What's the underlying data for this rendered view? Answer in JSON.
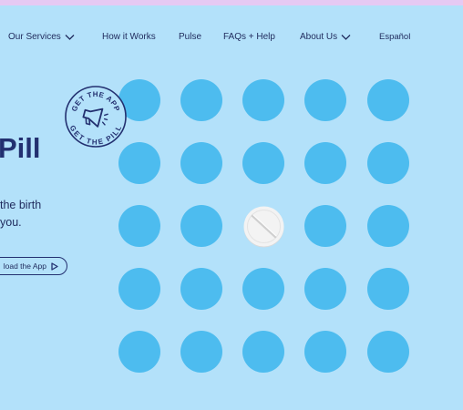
{
  "colors": {
    "background": "#b3e1fa",
    "top_strip": "#e6c9f3",
    "pill_dot": "#4dbcef",
    "navy": "#233070",
    "white_pill": "#f3f3f3"
  },
  "nav": {
    "items": [
      {
        "label": "Our Services",
        "has_chevron": true
      },
      {
        "label": "How it Works",
        "has_chevron": false
      },
      {
        "label": "Pulse",
        "has_chevron": false
      },
      {
        "label": "FAQs + Help",
        "has_chevron": false
      },
      {
        "label": "About Us",
        "has_chevron": true
      },
      {
        "label": "Español",
        "has_chevron": false
      }
    ]
  },
  "badge": {
    "text_top": "GET THE APP",
    "text_bottom": "GET THE PILL",
    "icon": "megaphone-icon"
  },
  "hero": {
    "title": "Pill",
    "body_line1": "the birth",
    "body_line2": "you.",
    "download_label": "load the App",
    "download_icon": "play-icon"
  },
  "pill_grid": {
    "rows": 5,
    "cols": 5,
    "highlight_row": 2,
    "highlight_col": 2
  }
}
